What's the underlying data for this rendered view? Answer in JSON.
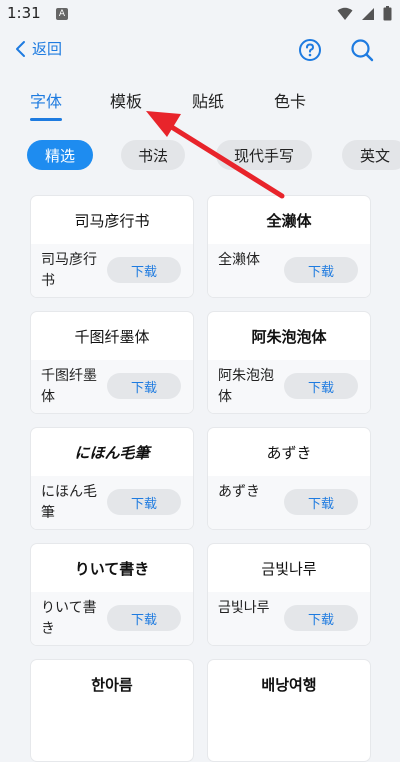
{
  "status": {
    "time": "1:31",
    "notification_glyph": "A"
  },
  "topbar": {
    "back_label": "返回"
  },
  "tabs": [
    {
      "label": "字体",
      "active": true
    },
    {
      "label": "模板",
      "active": false
    },
    {
      "label": "贴纸",
      "active": false
    },
    {
      "label": "色卡",
      "active": false
    }
  ],
  "chips": [
    {
      "label": "精选",
      "active": true
    },
    {
      "label": "书法",
      "active": false
    },
    {
      "label": "现代手写",
      "active": false
    },
    {
      "label": "英文",
      "active": false
    }
  ],
  "download_label": "下载",
  "fonts": [
    {
      "preview": "司马彦行书",
      "name": "司马彦行书"
    },
    {
      "preview": "全濑体",
      "name": "全濑体"
    },
    {
      "preview": "千图纤墨体",
      "name": "千图纤墨体"
    },
    {
      "preview": "阿朱泡泡体",
      "name": "阿朱泡泡体"
    },
    {
      "preview": "にほん毛筆",
      "name": "にほん毛筆"
    },
    {
      "preview": "あずき",
      "name": "あずき"
    },
    {
      "preview": "りいて書き",
      "name": "りいて書き"
    },
    {
      "preview": "금빛나루",
      "name": "금빛나루"
    },
    {
      "preview": "한아름",
      "name": ""
    },
    {
      "preview": "배낭여행",
      "name": ""
    }
  ],
  "colors": {
    "accent": "#1e7be0",
    "chip_active": "#1e8cf0",
    "arrow": "#e8242b"
  }
}
